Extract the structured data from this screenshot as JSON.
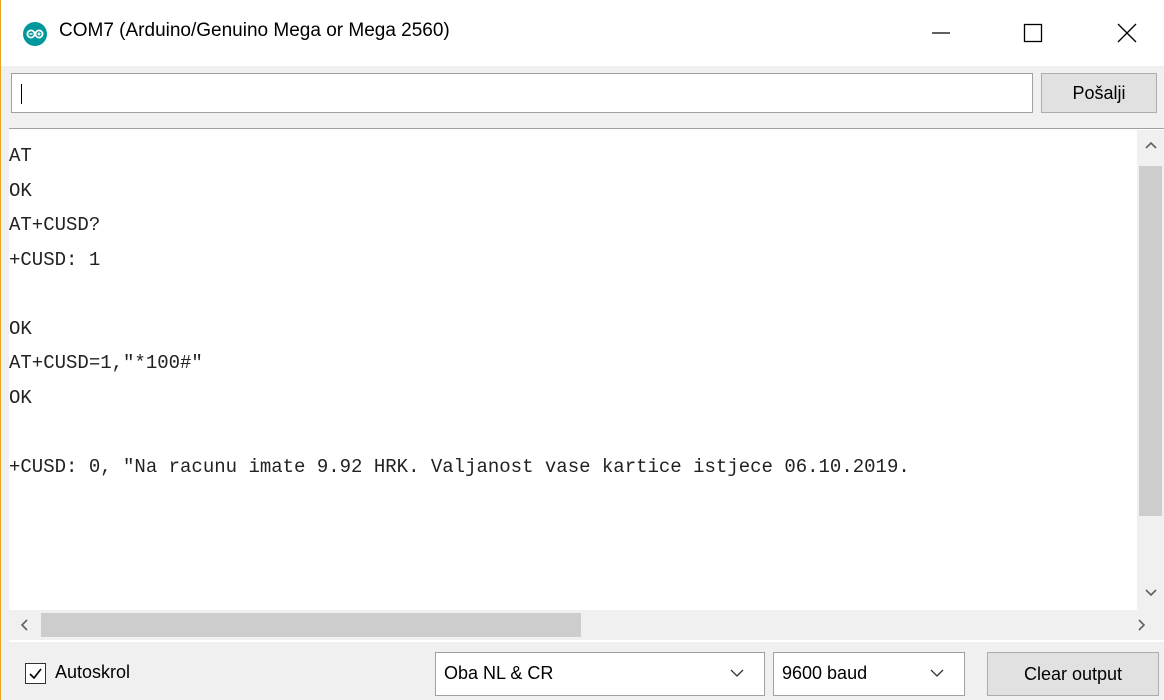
{
  "window": {
    "title": "COM7 (Arduino/Genuino Mega or Mega 2560)",
    "icon": "arduino-logo-icon",
    "controls": [
      "minimize-icon",
      "maximize-icon",
      "close-icon"
    ],
    "accent_color": "#00979c"
  },
  "send": {
    "input_value": "",
    "button_label": "Pošalji"
  },
  "output": {
    "lines": [
      "AT",
      "OK",
      "AT+CUSD?",
      "+CUSD: 1",
      "",
      "OK",
      "AT+CUSD=1,\"*100#\"",
      "OK",
      "",
      "+CUSD: 0, \"Na racunu imate 9.92 HRK. Valjanost vase kartice istjece 06.10.2019."
    ]
  },
  "footer": {
    "autoscroll_label": "Autoskrol",
    "autoscroll_checked": true,
    "line_ending": "Oba NL & CR",
    "baud_rate": "9600 baud",
    "clear_label": "Clear output"
  }
}
